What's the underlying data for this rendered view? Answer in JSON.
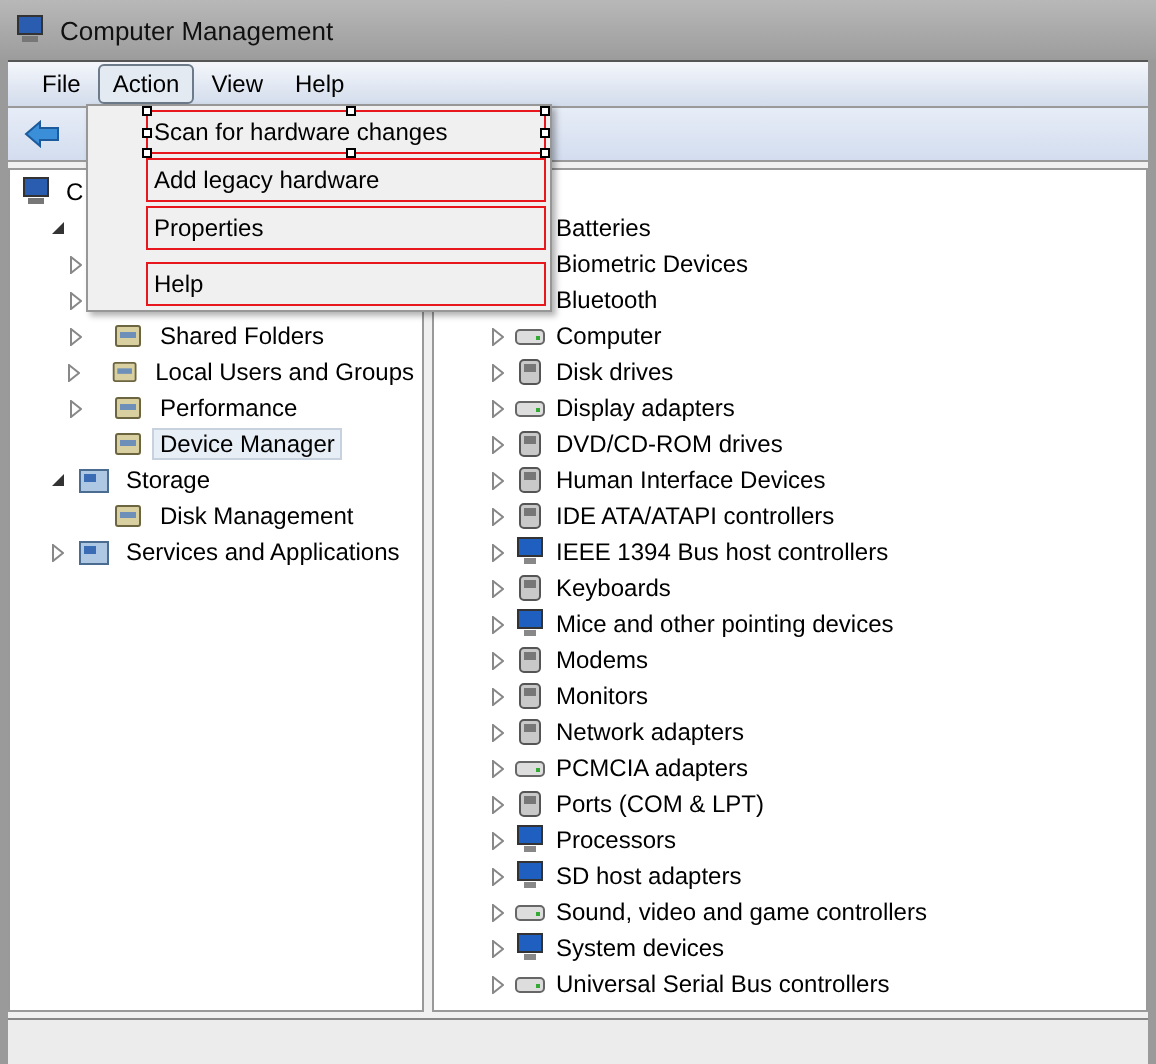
{
  "window": {
    "title": "Computer Management"
  },
  "menu_bar": [
    {
      "label": "File",
      "selected": false
    },
    {
      "label": "Action",
      "selected": true
    },
    {
      "label": "View",
      "selected": false
    },
    {
      "label": "Help",
      "selected": false
    }
  ],
  "action_menu": [
    [
      {
        "label": "Scan for hardware changes",
        "selected": true
      },
      {
        "label": "Add legacy hardware",
        "selected": false
      },
      {
        "label": "Properties",
        "selected": false
      }
    ],
    [
      {
        "label": "Help",
        "selected": false
      }
    ]
  ],
  "tree": [
    {
      "label": "C",
      "children": [
        {
          "expanded": true,
          "children": [
            {
              "expanded": false
            },
            {
              "expanded": false
            },
            {
              "label": "Shared Folders",
              "expanded": false,
              "selected": false
            },
            {
              "label": "Local Users and Groups",
              "expanded": false,
              "selected": false
            },
            {
              "label": "Performance",
              "expanded": false,
              "selected": false
            },
            {
              "label": "Device Manager",
              "selected": true
            }
          ]
        },
        {
          "label": "Storage",
          "expanded": true,
          "selected": false,
          "children": [
            {
              "label": "Disk Management",
              "selected": false
            }
          ]
        },
        {
          "label": "Services and Applications",
          "expanded": false,
          "selected": false
        }
      ]
    }
  ],
  "devices": [
    {
      "label": "Batteries"
    },
    {
      "label": "Biometric Devices"
    },
    {
      "label": "Bluetooth"
    },
    {
      "label": "Computer"
    },
    {
      "label": "Disk drives"
    },
    {
      "label": "Display adapters"
    },
    {
      "label": "DVD/CD-ROM drives"
    },
    {
      "label": "Human Interface Devices"
    },
    {
      "label": "IDE ATA/ATAPI controllers"
    },
    {
      "label": "IEEE 1394 Bus host controllers"
    },
    {
      "label": "Keyboards"
    },
    {
      "label": "Mice and other pointing devices"
    },
    {
      "label": "Modems"
    },
    {
      "label": "Monitors"
    },
    {
      "label": "Network adapters"
    },
    {
      "label": "PCMCIA adapters"
    },
    {
      "label": "Ports (COM & LPT)"
    },
    {
      "label": "Processors"
    },
    {
      "label": "SD host adapters"
    },
    {
      "label": "Sound, video and game controllers"
    },
    {
      "label": "System devices"
    },
    {
      "label": "Universal Serial Bus controllers"
    }
  ]
}
